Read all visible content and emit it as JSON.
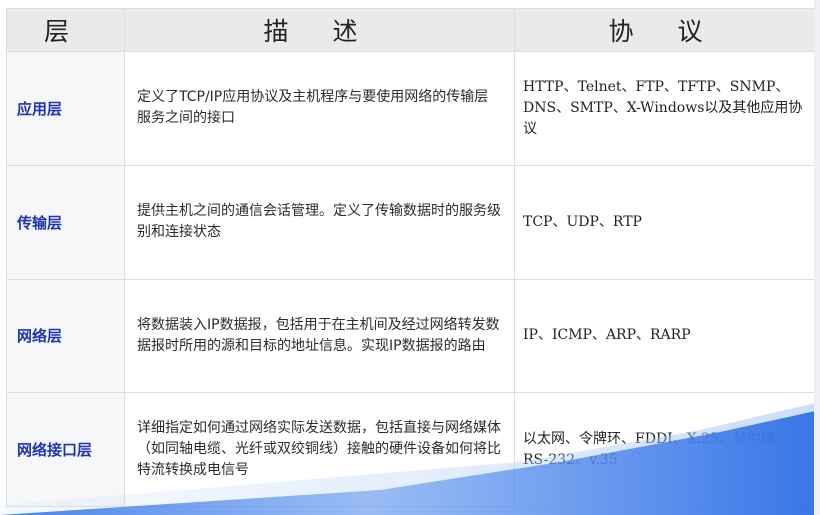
{
  "header": {
    "layer": "层",
    "description": "描 述",
    "protocol": "协 议"
  },
  "rows": [
    {
      "layer": "应用层",
      "description": "定义了TCP/IP应用协议及主机程序与要使用网络的传输层服务之间的接口",
      "protocols": "HTTP、Telnet、FTP、TFTP、SNMP、DNS、SMTP、X-Windows以及其他应用协议"
    },
    {
      "layer": "传输层",
      "description": "提供主机之间的通信会话管理。定义了传输数据时的服务级别和连接状态",
      "protocols": "TCP、UDP、RTP"
    },
    {
      "layer": "网络层",
      "description": "将数据装入IP数据报，包括用于在主机间及经过网络转发数据报时所用的源和目标的地址信息。实现IP数据报的路由",
      "protocols": "IP、ICMP、ARP、RARP"
    },
    {
      "layer": "网络接口层",
      "description": "详细指定如何通过网络实际发送数据，包括直接与网络媒体（如同轴电缆、光纤或双绞铜线）接触的硬件设备如何将比特流转换成电信号",
      "protocols": "以太网、令牌环、FDDI、X.25、帧中继、RS-232、v.35"
    }
  ],
  "colors": {
    "layer_text": "#1f35b0",
    "header_bg": "#e9eaec",
    "accent_band": "#3c7ae8"
  }
}
